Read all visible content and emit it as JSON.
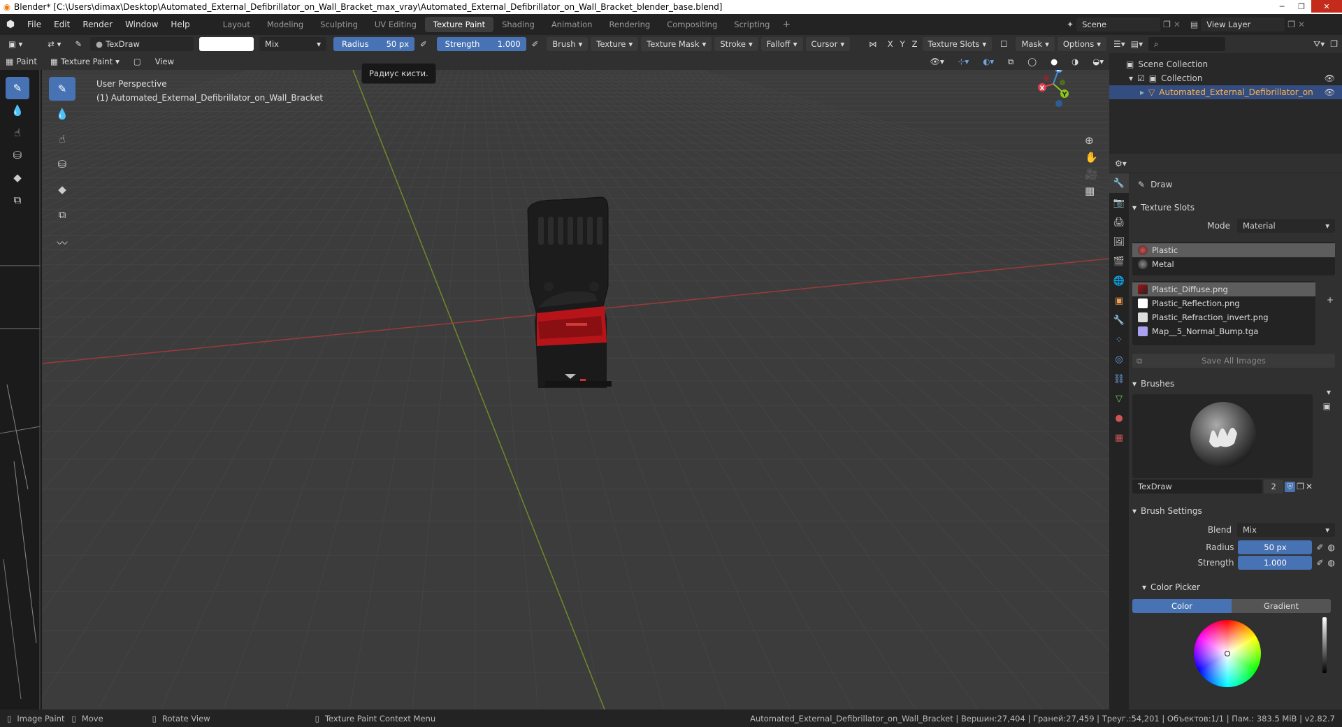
{
  "titlebar": {
    "title": "Blender* [C:\\Users\\dimax\\Desktop\\Automated_External_Defibrillator_on_Wall_Bracket_max_vray\\Automated_External_Defibrillator_on_Wall_Bracket_blender_base.blend]"
  },
  "menus": [
    "File",
    "Edit",
    "Render",
    "Window",
    "Help"
  ],
  "workspaces": [
    "Layout",
    "Modeling",
    "Sculpting",
    "UV Editing",
    "Texture Paint",
    "Shading",
    "Animation",
    "Rendering",
    "Compositing",
    "Scripting"
  ],
  "active_workspace": "Texture Paint",
  "scene": {
    "name": "Scene",
    "view_layer": "View Layer"
  },
  "tool_header": {
    "brush_name": "TexDraw",
    "blend": "Mix",
    "radius_label": "Radius",
    "radius_value": "50 px",
    "strength_label": "Strength",
    "strength_value": "1.000",
    "strength_fraction": 1.0,
    "menus": [
      "Brush",
      "Texture",
      "Texture Mask",
      "Stroke",
      "Falloff",
      "Cursor"
    ],
    "axis": [
      "X",
      "Y",
      "Z"
    ],
    "texture_slots": "Texture Slots",
    "mask": "Mask",
    "options": "Options"
  },
  "sub_header": {
    "mode": "Texture Paint",
    "view": "View",
    "left_label": "Paint"
  },
  "tooltip": "Радиус кисти.",
  "viewport": {
    "perspective": "User Perspective",
    "object_label": "(1) Automated_External_Defibrillator_on_Wall_Bracket",
    "gizmo": {
      "x": "X",
      "y": "Y",
      "z": "Z"
    }
  },
  "outliner": {
    "scene_collection": "Scene Collection",
    "collection": "Collection",
    "object": "Automated_External_Defibrillator_on_Wall_E"
  },
  "properties": {
    "tool_name": "Draw",
    "texture_slots": {
      "title": "Texture Slots",
      "mode_label": "Mode",
      "mode_value": "Material",
      "materials": [
        "Plastic",
        "Metal"
      ],
      "images": [
        "Plastic_Diffuse.png",
        "Plastic_Reflection.png",
        "Plastic_Refraction_invert.png",
        "Map__5_Normal_Bump.tga"
      ],
      "save_all": "Save All Images"
    },
    "brushes": {
      "title": "Brushes",
      "name": "TexDraw",
      "users": "2"
    },
    "brush_settings": {
      "title": "Brush Settings",
      "blend_label": "Blend",
      "blend_value": "Mix",
      "radius_label": "Radius",
      "radius_value": "50 px",
      "strength_label": "Strength",
      "strength_value": "1.000"
    },
    "color_picker": {
      "title": "Color Picker",
      "tabs": [
        "Color",
        "Gradient"
      ],
      "active_tab": "Color"
    }
  },
  "statusbar": {
    "left": [
      "Image Paint",
      "Move",
      "Rotate View",
      "Texture Paint Context Menu"
    ],
    "stats": "Automated_External_Defibrillator_on_Wall_Bracket | Вершин:27,404 | Граней:27,459 | Треуг.:54,201 | Объектов:1/1 | Пам.: 383.5 MiB | v2.82.7"
  },
  "colors": {
    "accent": "#4772b3",
    "x_axis": "#e0414e",
    "y_axis": "#8bc61d",
    "z_axis": "#3a8fdc",
    "grid_red": "#9b3a3a",
    "grid_green": "#6e8a2a"
  }
}
